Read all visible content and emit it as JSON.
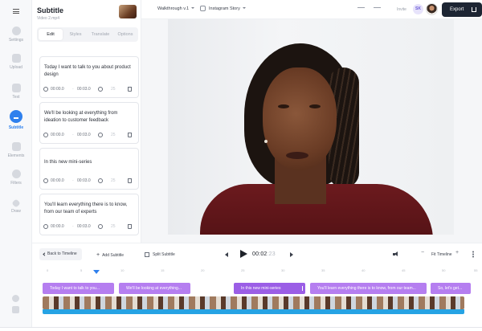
{
  "sidebar": {
    "items": [
      {
        "label": "Settings",
        "icon": "gear-icon"
      },
      {
        "label": "Upload",
        "icon": "upload-icon"
      },
      {
        "label": "Text",
        "icon": "text-icon"
      },
      {
        "label": "Subtitle",
        "icon": "subtitle-icon",
        "active": true
      },
      {
        "label": "Elements",
        "icon": "elements-icon"
      },
      {
        "label": "Filters",
        "icon": "filters-icon"
      },
      {
        "label": "Draw",
        "icon": "pencil-icon"
      }
    ]
  },
  "panel": {
    "title": "Subtitle",
    "file": "Video 2.mp4",
    "tabs": [
      "Edit",
      "Styles",
      "Translate",
      "Options"
    ],
    "active_tab": "Edit",
    "cards": [
      {
        "text": "Today I want to talk to you about product design",
        "start": "00:00.0",
        "end": "00:03.0",
        "duration": "25"
      },
      {
        "text": "We'll be looking at everything from ideation to customer feedback",
        "start": "00:00.0",
        "end": "00:03.0",
        "duration": "25"
      },
      {
        "text": "In this new mini-series",
        "start": "00:00.0",
        "end": "00:03.0",
        "duration": "25"
      },
      {
        "text": "You'll learn everything there is to know, from our team of experts",
        "start": "00:00.0",
        "end": "00:03.0",
        "duration": "25"
      }
    ]
  },
  "topbar": {
    "project_name": "Walkthrough v.1",
    "format": "Instagram Story",
    "invite": "Invite",
    "avatar_initials": "SK",
    "export_label": "Export"
  },
  "transport": {
    "back_label": "Back to Timeline",
    "add_subtitle_label": "Add Subtitle",
    "split_subtitle_label": "Split Subtitle",
    "time_current": "00:02",
    "time_frames": ":23",
    "fit_label": "Fit Timeline",
    "zoom_minus": "−",
    "zoom_plus": "+"
  },
  "timeline": {
    "ticks": [
      "0",
      "5",
      "10",
      "15",
      "20",
      "25",
      "30",
      "35",
      "40",
      "45",
      "50",
      "55"
    ],
    "segments": [
      {
        "label": "Today I want to talk to you..."
      },
      {
        "label": "We'll be looking at everything..."
      },
      {
        "label": "In this new mini-series"
      },
      {
        "label": "You'll learn everything there is to know, from our team..."
      },
      {
        "label": "So, let's get..."
      }
    ]
  },
  "colors": {
    "accent": "#2f80ed",
    "subtitle_segment": "#b57ef0",
    "export_button": "#1d2533",
    "waveform": "#26a3e4"
  }
}
